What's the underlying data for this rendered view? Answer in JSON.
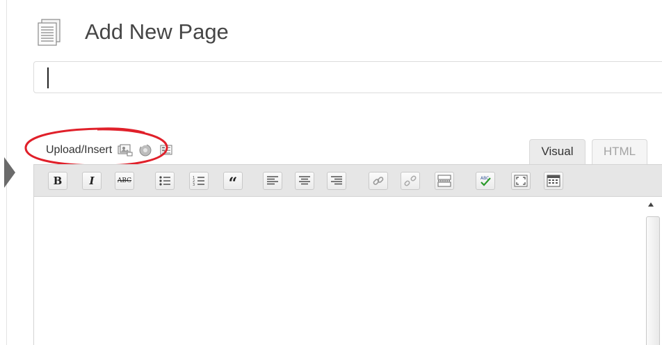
{
  "page": {
    "title": "Add New Page"
  },
  "title_field": {
    "value": "",
    "placeholder": ""
  },
  "media": {
    "upload_label": "Upload/Insert",
    "icons": [
      "add-image-icon",
      "add-media-icon",
      "add-form-icon"
    ]
  },
  "editor": {
    "tabs": [
      {
        "label": "Visual",
        "active": true
      },
      {
        "label": "HTML",
        "active": false
      }
    ],
    "toolbar": {
      "bold": "B",
      "italic": "I",
      "strikethrough": "ABC",
      "blockquote": "“",
      "buttons": [
        "bold",
        "italic",
        "strikethrough",
        "bullet-list",
        "numbered-list",
        "blockquote",
        "align-left",
        "align-center",
        "align-right",
        "insert-link",
        "unlink",
        "insert-more-tag",
        "spellcheck",
        "fullscreen",
        "kitchen-sink"
      ]
    },
    "content": ""
  },
  "colors": {
    "annotation_circle": "#e0202a",
    "toolbar_bg": "#e6e6e6",
    "spellcheck_check": "#2a9a2a"
  }
}
